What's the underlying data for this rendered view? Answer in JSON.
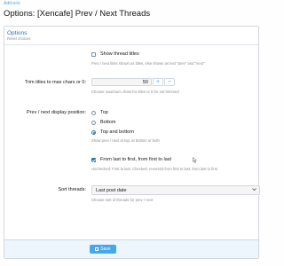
{
  "breadcrumb": "Add-ons",
  "title": "Options: [Xencafe] Prev / Next Threads",
  "block": {
    "title": "Options",
    "subtitle": "Reset choices"
  },
  "show_titles": {
    "label": "Show thread titles",
    "checked": false,
    "hint": "Prev / next links shown as titles, else shown as text \"prev\" and \"next\""
  },
  "trim": {
    "label": "Trim titles to max chars or 0:",
    "value": "50",
    "plus": "+",
    "minus": "−",
    "hint": "Choose maximum chars for titles or 0 for not trimmed"
  },
  "position": {
    "label": "Prev / next display position:",
    "options": [
      "Top",
      "Bottom",
      "Top and bottom"
    ],
    "selected": "Top and bottom",
    "hint": "Show prev / next at top, at bottom or both"
  },
  "order": {
    "label": "From last to first, from first to last",
    "checked": true,
    "hint": "Unchecked: First to last. Checked: reversed from first to last, from last to first"
  },
  "sort": {
    "label": "Sort threads:",
    "value": "Last post date",
    "hint": "Choose sort of threads for prev / next"
  },
  "save_label": "Save",
  "icons": {
    "save": "save-icon",
    "dropdown": "chevron-down-icon",
    "cursor": "mouse-pointer-icon"
  }
}
